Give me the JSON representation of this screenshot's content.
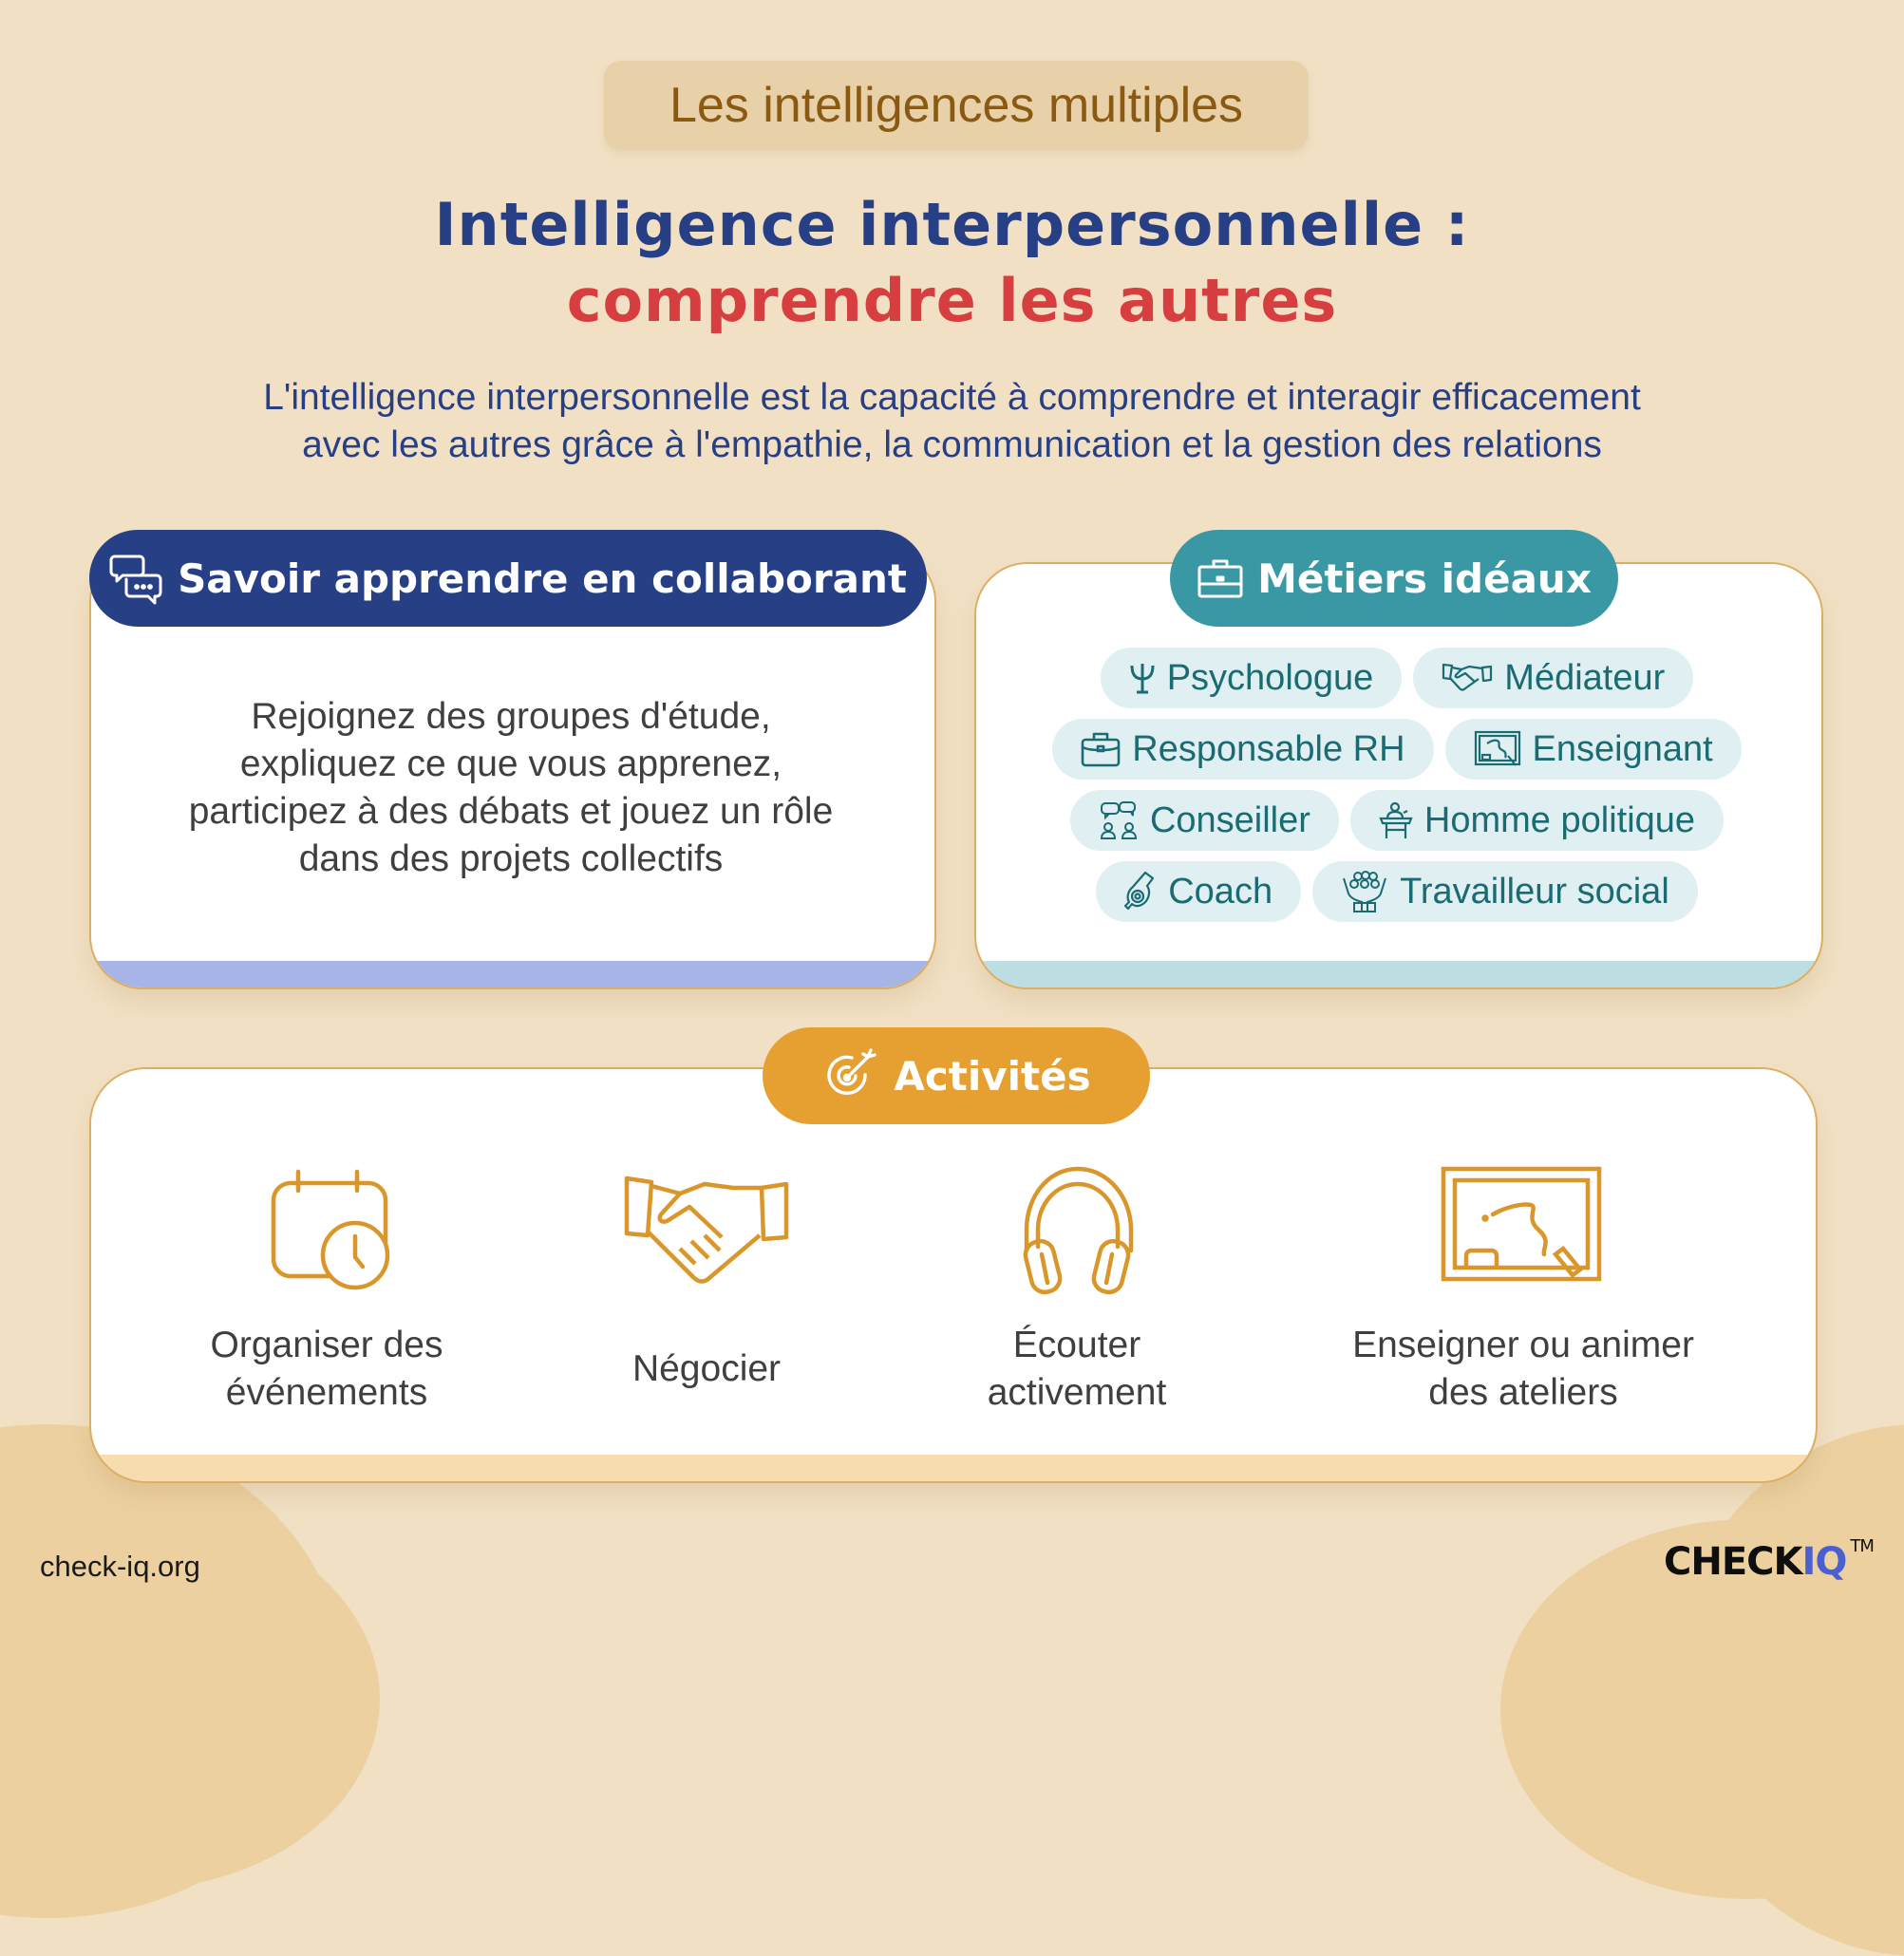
{
  "eyebrow": "Les intelligences multiples",
  "title": {
    "line1": "Intelligence interpersonnelle :",
    "line2": "comprendre les autres"
  },
  "lead": {
    "line1": "L'intelligence interpersonnelle est la capacité à comprendre et interagir efficacement",
    "line2": "avec les autres grâce à l'empathie, la communication et la gestion des relations"
  },
  "collab": {
    "icon": "chat-bubbles-icon",
    "title": "Savoir apprendre en collaborant",
    "lines": [
      "Rejoignez des groupes d'étude,",
      "expliquez ce que vous apprenez,",
      "participez à des débats et jouez un rôle",
      "dans des projets collectifs"
    ]
  },
  "jobs": {
    "icon": "briefcase-icon",
    "title": "Métiers idéaux",
    "items": [
      {
        "label": "Psychologue",
        "icon": "psi-icon"
      },
      {
        "label": "Médiateur",
        "icon": "handshake-icon"
      },
      {
        "label": "Responsable RH",
        "icon": "briefcase-icon"
      },
      {
        "label": "Enseignant",
        "icon": "chalkboard-icon"
      },
      {
        "label": "Conseiller",
        "icon": "counseling-icon"
      },
      {
        "label": "Homme politique",
        "icon": "podium-speaker-icon"
      },
      {
        "label": "Coach",
        "icon": "whistle-icon"
      },
      {
        "label": "Travailleur social",
        "icon": "community-care-icon"
      }
    ]
  },
  "activities": {
    "icon": "target-icon",
    "title": "Activités",
    "items": [
      {
        "line1": "Organiser des",
        "line2": "événements",
        "icon": "calendar-clock-icon"
      },
      {
        "line1": "Négocier",
        "line2": "",
        "icon": "handshake-icon"
      },
      {
        "line1": "Écouter",
        "line2": "activement",
        "icon": "headphones-icon"
      },
      {
        "line1": "Enseigner ou animer",
        "line2": "des ateliers",
        "icon": "chalkboard-icon"
      }
    ]
  },
  "footer": {
    "site": "check-iq.org",
    "brand_a": "CHECK",
    "brand_b": "IQ",
    "brand_tm": "TM"
  },
  "colors": {
    "background": "#f1e0c4",
    "navy": "#273f85",
    "red": "#d63e3f",
    "teal": "#3a98a4",
    "orange": "#e6a032",
    "brown": "#8a5a12"
  }
}
